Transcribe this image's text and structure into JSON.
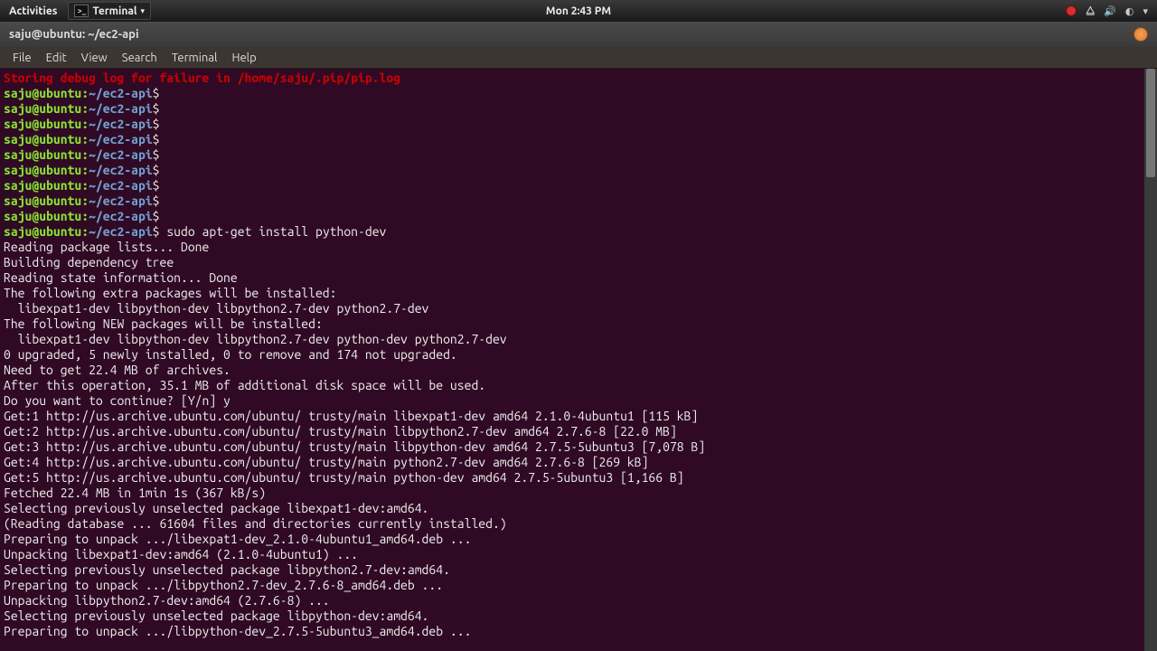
{
  "topbar": {
    "activities": "Activities",
    "app_label": "Terminal",
    "clock": "Mon  2:43 PM"
  },
  "window": {
    "title": "saju@ubuntu: ~/ec2-api"
  },
  "menubar": {
    "items": [
      "File",
      "Edit",
      "View",
      "Search",
      "Terminal",
      "Help"
    ]
  },
  "terminal": {
    "error_line": "Storing debug log for failure in /home/saju/.pip/pip.log",
    "prompt_host": "saju@ubuntu",
    "prompt_sep": ":",
    "prompt_path": "~/ec2-api",
    "prompt_dollar": "$",
    "empty_prompt_count": 9,
    "command": "sudo apt-get install python-dev",
    "output": [
      "Reading package lists... Done",
      "Building dependency tree",
      "Reading state information... Done",
      "The following extra packages will be installed:",
      "  libexpat1-dev libpython-dev libpython2.7-dev python2.7-dev",
      "The following NEW packages will be installed:",
      "  libexpat1-dev libpython-dev libpython2.7-dev python-dev python2.7-dev",
      "0 upgraded, 5 newly installed, 0 to remove and 174 not upgraded.",
      "Need to get 22.4 MB of archives.",
      "After this operation, 35.1 MB of additional disk space will be used.",
      "Do you want to continue? [Y/n] y",
      "Get:1 http://us.archive.ubuntu.com/ubuntu/ trusty/main libexpat1-dev amd64 2.1.0-4ubuntu1 [115 kB]",
      "Get:2 http://us.archive.ubuntu.com/ubuntu/ trusty/main libpython2.7-dev amd64 2.7.6-8 [22.0 MB]",
      "Get:3 http://us.archive.ubuntu.com/ubuntu/ trusty/main libpython-dev amd64 2.7.5-5ubuntu3 [7,078 B]",
      "Get:4 http://us.archive.ubuntu.com/ubuntu/ trusty/main python2.7-dev amd64 2.7.6-8 [269 kB]",
      "Get:5 http://us.archive.ubuntu.com/ubuntu/ trusty/main python-dev amd64 2.7.5-5ubuntu3 [1,166 B]",
      "Fetched 22.4 MB in 1min 1s (367 kB/s)",
      "Selecting previously unselected package libexpat1-dev:amd64.",
      "(Reading database ... 61604 files and directories currently installed.)",
      "Preparing to unpack .../libexpat1-dev_2.1.0-4ubuntu1_amd64.deb ...",
      "Unpacking libexpat1-dev:amd64 (2.1.0-4ubuntu1) ...",
      "Selecting previously unselected package libpython2.7-dev:amd64.",
      "Preparing to unpack .../libpython2.7-dev_2.7.6-8_amd64.deb ...",
      "Unpacking libpython2.7-dev:amd64 (2.7.6-8) ...",
      "Selecting previously unselected package libpython-dev:amd64.",
      "Preparing to unpack .../libpython-dev_2.7.5-5ubuntu3_amd64.deb ..."
    ]
  }
}
